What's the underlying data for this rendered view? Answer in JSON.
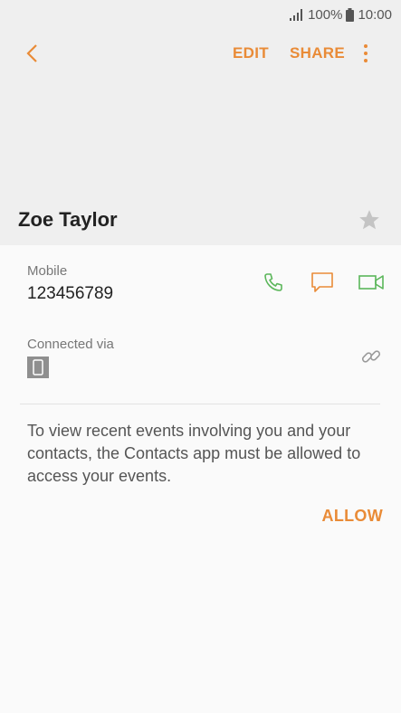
{
  "status_bar": {
    "battery": "100%",
    "time": "10:00"
  },
  "toolbar": {
    "edit_label": "EDIT",
    "share_label": "SHARE"
  },
  "contact": {
    "name": "Zoe Taylor",
    "phone_label": "Mobile",
    "phone_number": "123456789",
    "connected_label": "Connected via"
  },
  "events": {
    "message": "To view recent events involving you and your contacts, the Contacts app must be allowed to access your events.",
    "allow_label": "ALLOW"
  },
  "colors": {
    "accent": "#e98b37",
    "call_green": "#5bb65a",
    "star": "#c4c4c4"
  }
}
